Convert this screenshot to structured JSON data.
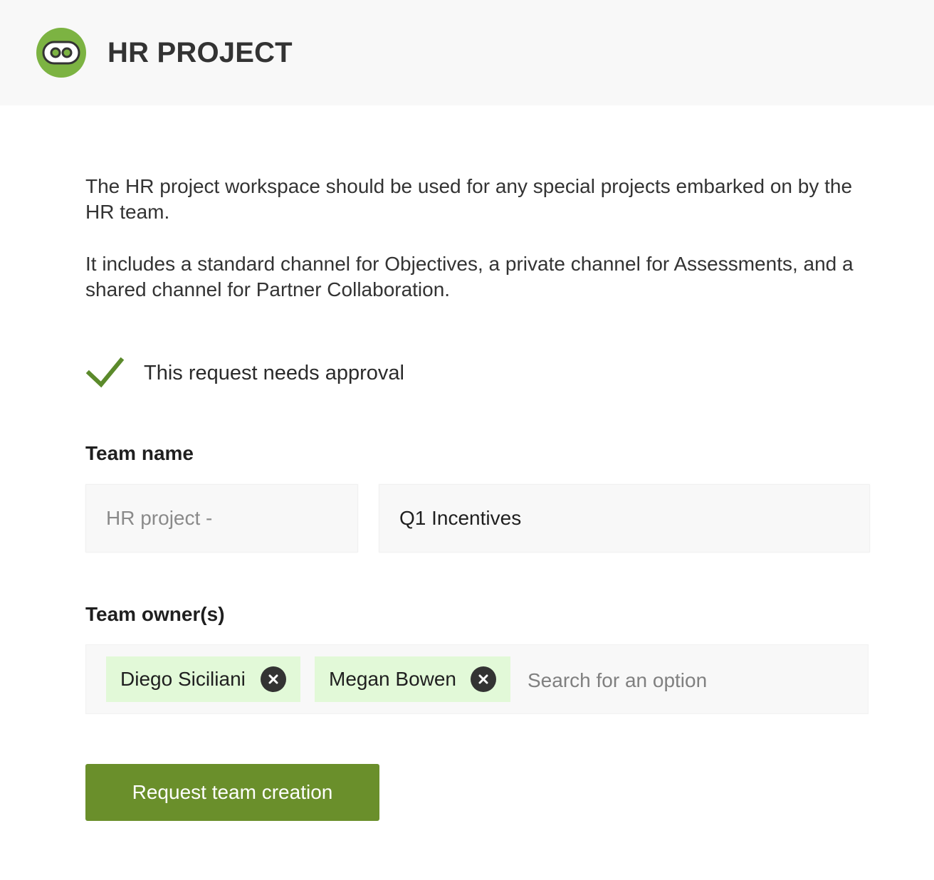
{
  "header": {
    "title": "HR PROJECT",
    "logo_icon": "teams-bot-icon",
    "logo_color": "#7cb342"
  },
  "description": {
    "paragraph_1": "The HR project workspace should be used for any special projects embarked on by the HR team.",
    "paragraph_2": "It includes a standard channel for Objectives, a private channel for Assessments, and a shared channel for Partner Collaboration."
  },
  "approval": {
    "icon": "checkmark-icon",
    "icon_color": "#5b8a2b",
    "text": "This request needs approval"
  },
  "team_name": {
    "label": "Team name",
    "prefix": "HR project -",
    "value": "Q1 Incentives"
  },
  "team_owners": {
    "label": "Team owner(s)",
    "chips": [
      {
        "label": "Diego Siciliani",
        "remove_icon": "close-circle-icon"
      },
      {
        "label": "Megan Bowen",
        "remove_icon": "close-circle-icon"
      }
    ],
    "search_placeholder": "Search for an option",
    "chip_color": "#e2f9d8"
  },
  "submit": {
    "label": "Request team creation",
    "color": "#6a8f2b"
  }
}
